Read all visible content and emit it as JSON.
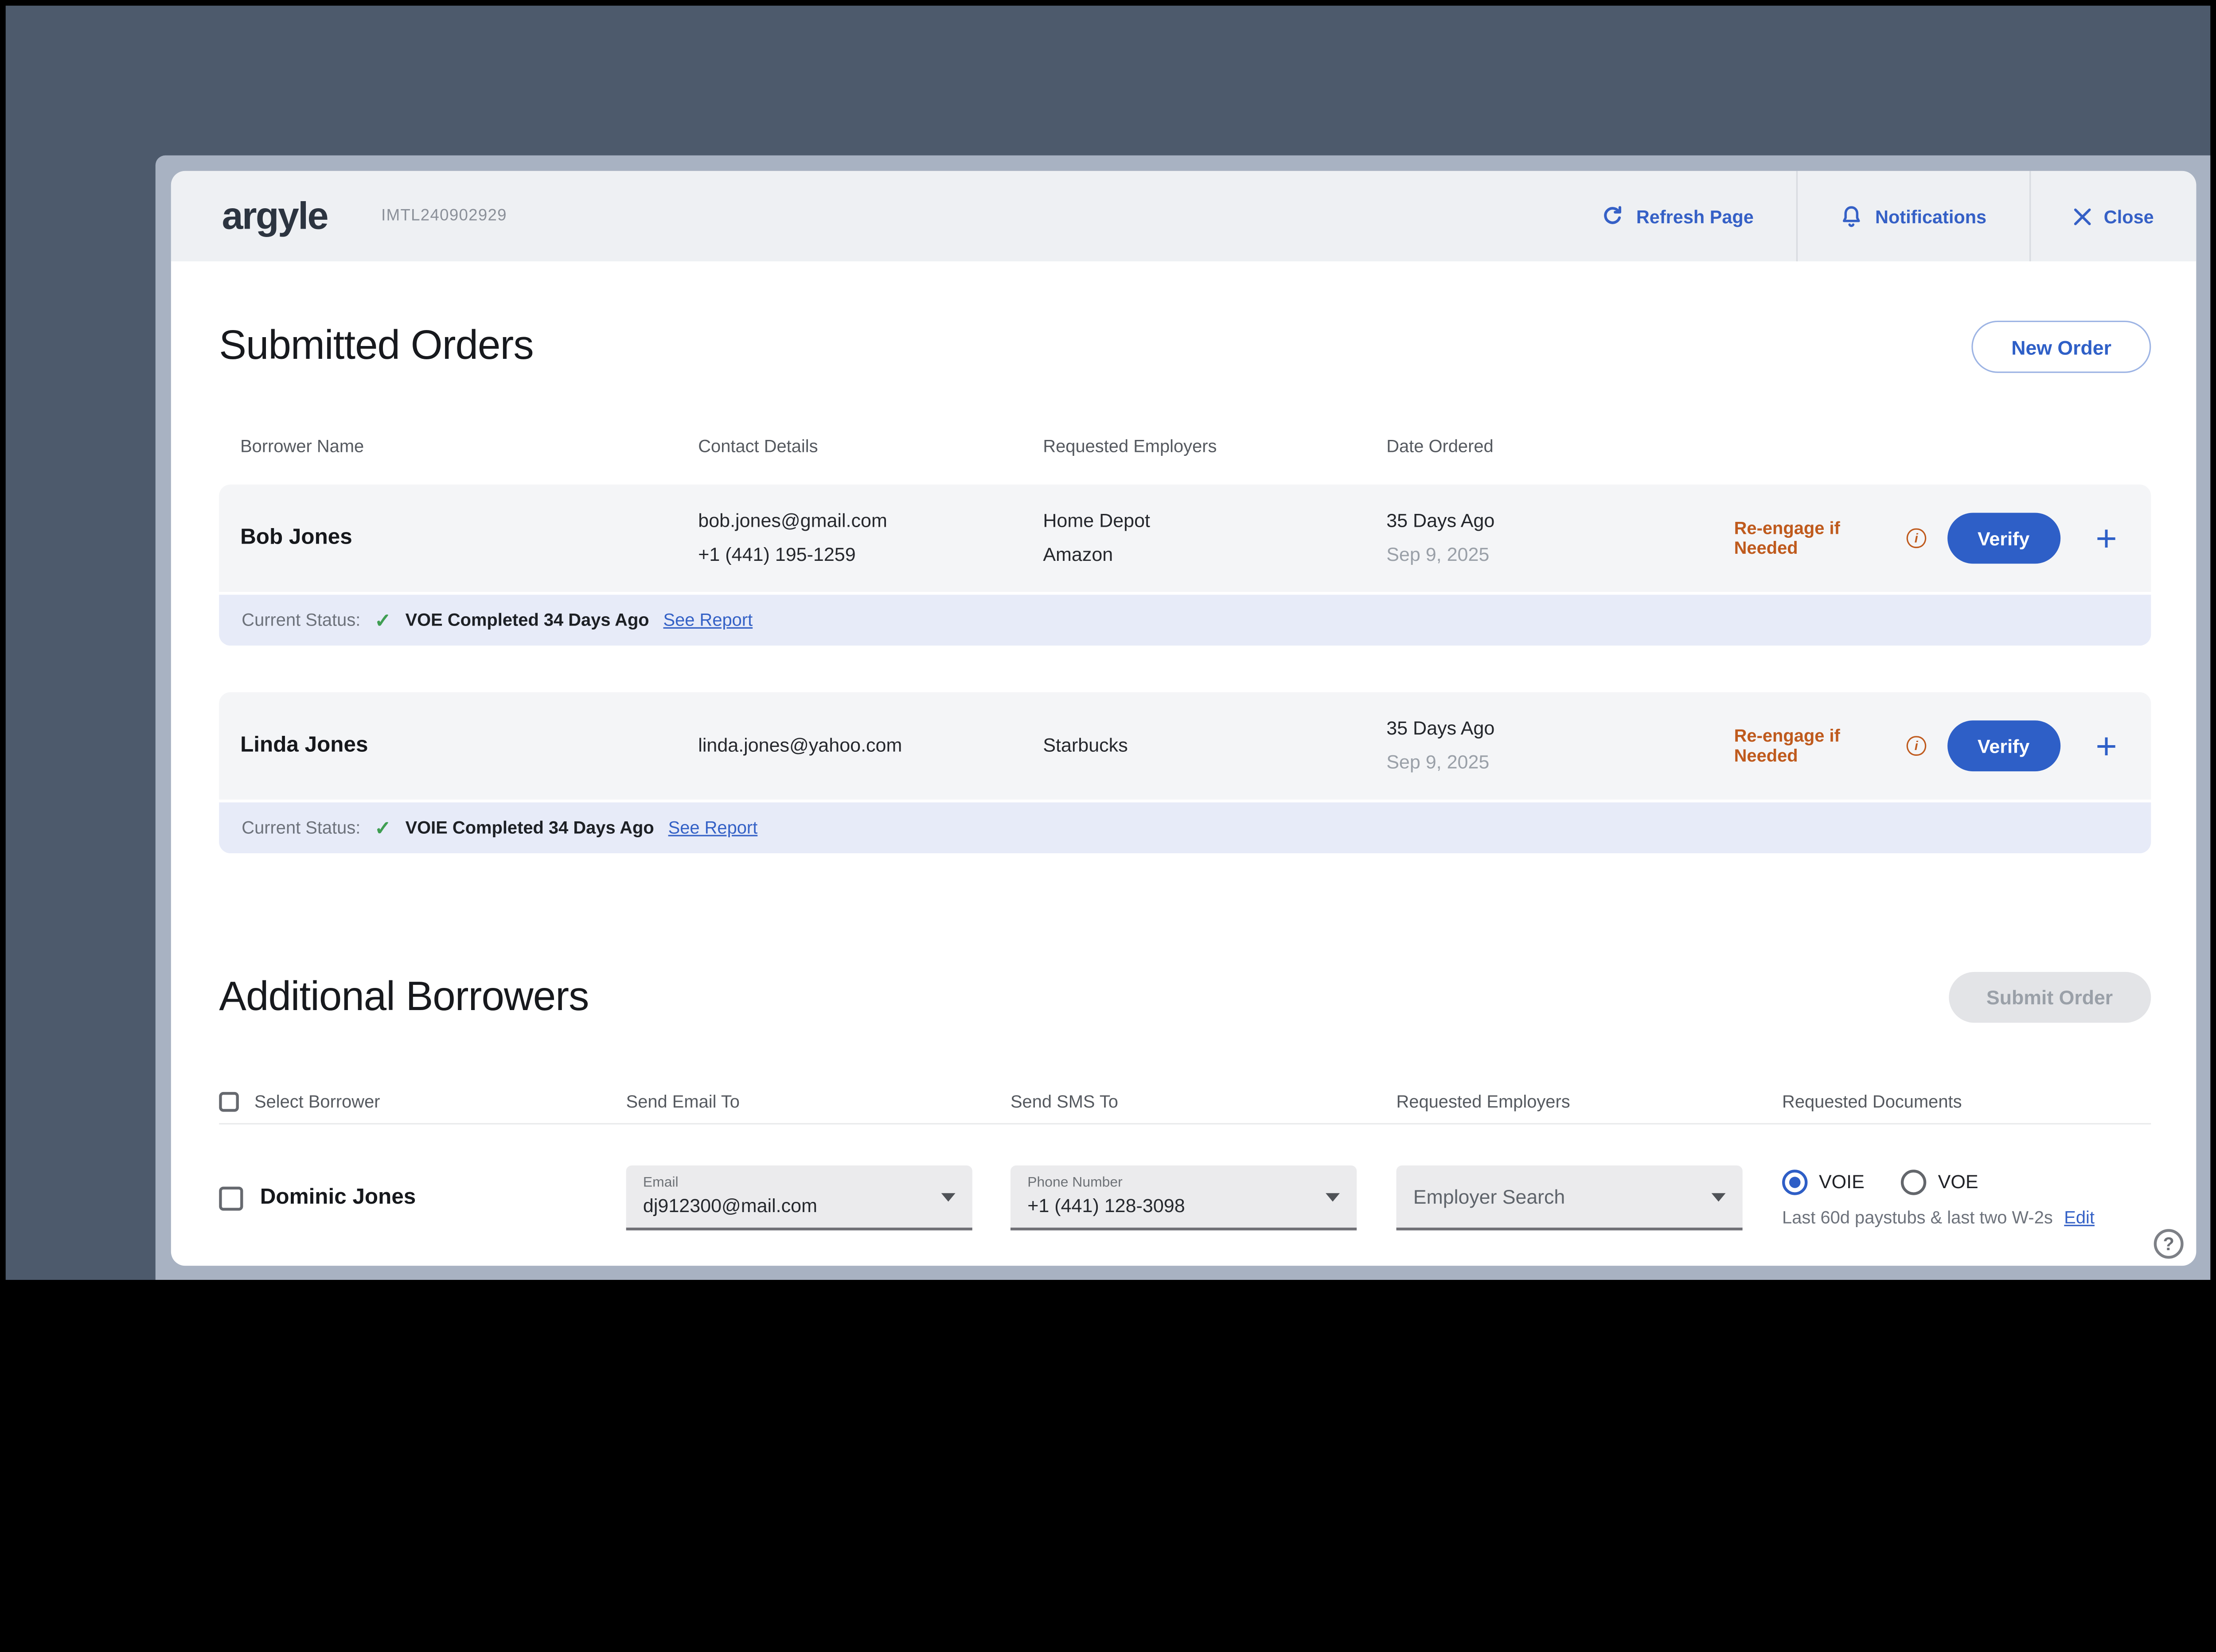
{
  "window": {
    "brand": "argyle",
    "order_id": "IMTL240902929",
    "actions": {
      "refresh": "Refresh Page",
      "notifications": "Notifications",
      "close": "Close"
    }
  },
  "submitted_orders": {
    "title": "Submitted Orders",
    "new_order_label": "New Order",
    "columns": [
      "Borrower Name",
      "Contact Details",
      "Requested Employers",
      "Date Ordered"
    ],
    "rows": [
      {
        "name": "Bob Jones",
        "contact": [
          "bob.jones@gmail.com",
          "+1 (441) 195-1259"
        ],
        "employers": [
          "Home Depot",
          "Amazon"
        ],
        "date_relative": "35 Days Ago",
        "date_absolute": "Sep 9, 2025",
        "reengage_label": "Re-engage if Needed",
        "info_glyph": "i",
        "verify_label": "Verify",
        "plus_glyph": "+",
        "status_label": "Current Status:",
        "status_check": "✓",
        "status_text": "VOE Completed 34 Days Ago",
        "status_link": "See Report"
      },
      {
        "name": "Linda Jones",
        "contact": [
          "linda.jones@yahoo.com"
        ],
        "employers": [
          "Starbucks"
        ],
        "date_relative": "35 Days Ago",
        "date_absolute": "Sep 9, 2025",
        "reengage_label": "Re-engage if Needed",
        "info_glyph": "i",
        "verify_label": "Verify",
        "plus_glyph": "+",
        "status_label": "Current Status:",
        "status_check": "✓",
        "status_text": "VOIE Completed 34 Days Ago",
        "status_link": "See Report"
      }
    ]
  },
  "additional_borrowers": {
    "title": "Additional Borrowers",
    "submit_label": "Submit Order",
    "columns": [
      "Select Borrower",
      "Send Email To",
      "Send SMS To",
      "Requested Employers",
      "Requested Documents"
    ],
    "rows": [
      {
        "name": "Dominic Jones",
        "email_label": "Email",
        "email_value": "dj912300@mail.com",
        "phone_label": "Phone Number",
        "phone_value": "+1 (441) 128-3098",
        "employer_placeholder": "Employer Search",
        "doc_options": [
          "VOIE",
          "VOE"
        ],
        "doc_selected": "VOIE",
        "docs_summary": "Last 60d paystubs & last two W-2s",
        "edit_label": "Edit"
      }
    ]
  },
  "help_glyph": "?",
  "colors": {
    "accent_blue": "#2e5fc7",
    "warning_orange": "#bf5a1d",
    "success_green": "#3f9e52",
    "desktop_bg": "#4d5a6c",
    "window_band": "#a8b2c2",
    "header_bg": "#eef0f3",
    "card_bg": "#f4f5f7",
    "status_bg": "#e7ebf8"
  }
}
